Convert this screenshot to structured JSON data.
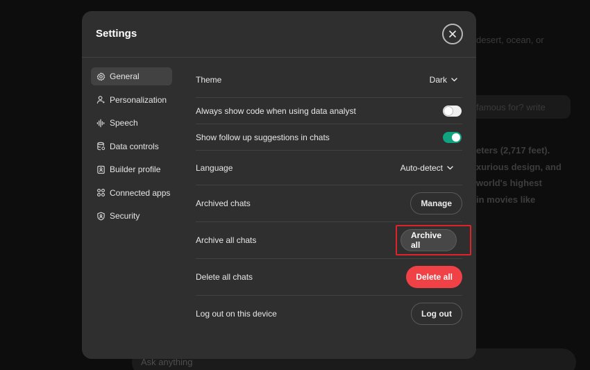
{
  "background": {
    "fragments": [
      "desert, ocean, or",
      "famous for? write",
      "eters (2,717 feet).",
      "xurious design, and",
      "world's highest",
      "in movies like"
    ],
    "input_placeholder": "Ask anything"
  },
  "modal": {
    "title": "Settings",
    "close_icon": "close-icon"
  },
  "sidebar": {
    "items": [
      {
        "label": "General",
        "icon": "gear-icon",
        "active": true
      },
      {
        "label": "Personalization",
        "icon": "person-icon",
        "active": false
      },
      {
        "label": "Speech",
        "icon": "waveform-icon",
        "active": false
      },
      {
        "label": "Data controls",
        "icon": "database-icon",
        "active": false
      },
      {
        "label": "Builder profile",
        "icon": "id-card-icon",
        "active": false
      },
      {
        "label": "Connected apps",
        "icon": "apps-grid-icon",
        "active": false
      },
      {
        "label": "Security",
        "icon": "shield-icon",
        "active": false
      }
    ]
  },
  "settings": {
    "theme": {
      "label": "Theme",
      "value": "Dark"
    },
    "show_code": {
      "label": "Always show code when using data analyst",
      "enabled": false
    },
    "follow_up": {
      "label": "Show follow up suggestions in chats",
      "enabled": true
    },
    "language": {
      "label": "Language",
      "value": "Auto-detect"
    },
    "archived": {
      "label": "Archived chats",
      "button": "Manage"
    },
    "archive_all": {
      "label": "Archive all chats",
      "button": "Archive all"
    },
    "delete_all": {
      "label": "Delete all chats",
      "button": "Delete all"
    },
    "logout": {
      "label": "Log out on this device",
      "button": "Log out"
    }
  },
  "colors": {
    "accent_green": "#10a37f",
    "danger_red": "#ef4146",
    "highlight_red": "#e0222a"
  }
}
